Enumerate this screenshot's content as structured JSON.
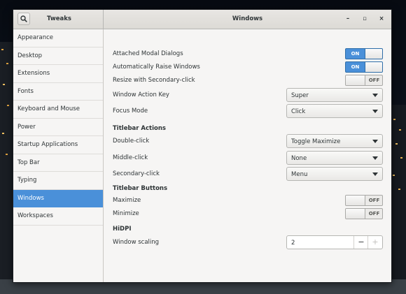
{
  "app": {
    "title": "Tweaks"
  },
  "page": {
    "title": "Windows"
  },
  "window_controls": {
    "minimize": "–",
    "maximize": "▫",
    "close": "×"
  },
  "sidebar": {
    "items": [
      {
        "label": "Appearance"
      },
      {
        "label": "Desktop"
      },
      {
        "label": "Extensions"
      },
      {
        "label": "Fonts"
      },
      {
        "label": "Keyboard and Mouse"
      },
      {
        "label": "Power"
      },
      {
        "label": "Startup Applications"
      },
      {
        "label": "Top Bar"
      },
      {
        "label": "Typing"
      },
      {
        "label": "Windows",
        "selected": true
      },
      {
        "label": "Workspaces"
      }
    ]
  },
  "settings": {
    "attached_modal": {
      "label": "Attached Modal Dialogs",
      "state": "ON"
    },
    "auto_raise": {
      "label": "Automatically Raise Windows",
      "state": "ON"
    },
    "resize_secondary": {
      "label": "Resize with Secondary-click",
      "state": "OFF"
    },
    "action_key": {
      "label": "Window Action Key",
      "value": "Super"
    },
    "focus_mode": {
      "label": "Focus Mode",
      "value": "Click"
    },
    "titlebar_actions": {
      "heading": "Titlebar Actions",
      "double_click": {
        "label": "Double-click",
        "value": "Toggle Maximize"
      },
      "middle_click": {
        "label": "Middle-click",
        "value": "None"
      },
      "secondary_click": {
        "label": "Secondary-click",
        "value": "Menu"
      }
    },
    "titlebar_buttons": {
      "heading": "Titlebar Buttons",
      "maximize": {
        "label": "Maximize",
        "state": "OFF"
      },
      "minimize": {
        "label": "Minimize",
        "state": "OFF"
      }
    },
    "hidpi": {
      "heading": "HiDPI",
      "window_scaling": {
        "label": "Window scaling",
        "value": "2",
        "minus": "−",
        "plus": "+"
      }
    }
  },
  "colors": {
    "accent": "#4a90d9",
    "window_bg": "#f6f5f4",
    "text": "#2e3436"
  }
}
